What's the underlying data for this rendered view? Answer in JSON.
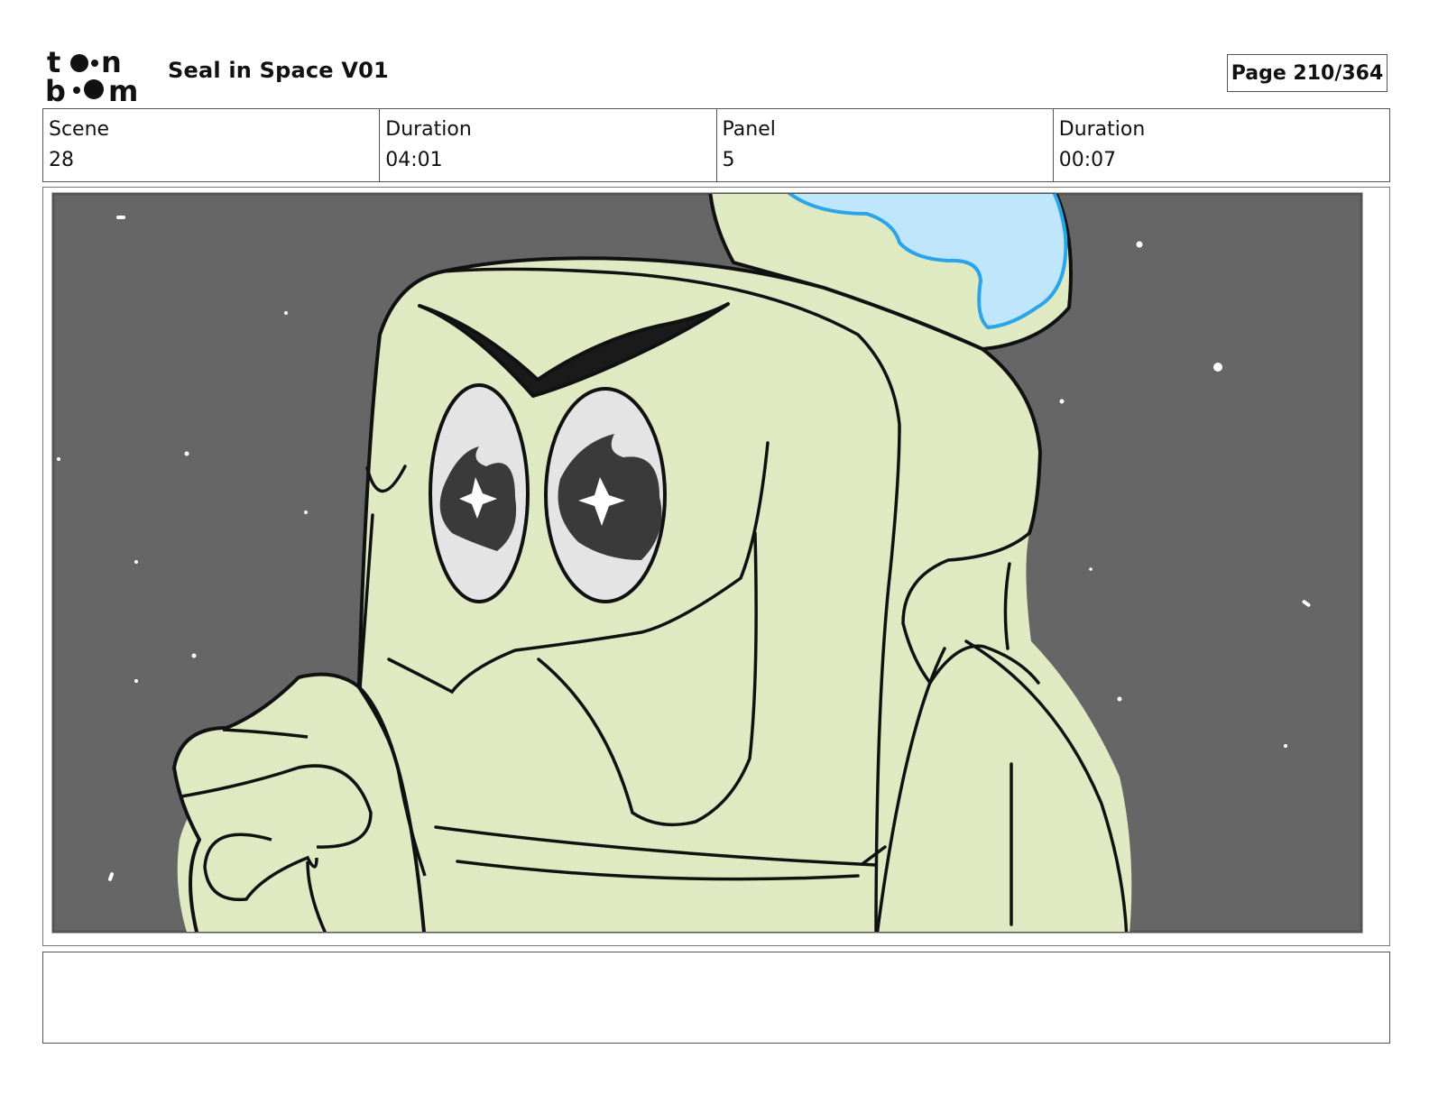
{
  "header": {
    "logo_text": "toon boom",
    "project_title": "Seal in Space V01",
    "page_label": "Page 210/364"
  },
  "info": {
    "scene_label": "Scene",
    "scene_value": "28",
    "scene_duration_label": "Duration",
    "scene_duration_value": "04:01",
    "panel_label": "Panel",
    "panel_value": "5",
    "panel_duration_label": "Duration",
    "panel_duration_value": "00:07"
  },
  "panel": {
    "image_icon": "storyboard-drawing",
    "colors": {
      "space": "#666666",
      "alien_skin": "#e0eac2",
      "outline": "#111111",
      "water": "#bfe6fb",
      "water_line": "#2aa4ea",
      "eye_white": "#e4e4e4",
      "pupil": "#3a3a3a",
      "star": "#ffffff"
    }
  },
  "notes": {
    "text": ""
  }
}
